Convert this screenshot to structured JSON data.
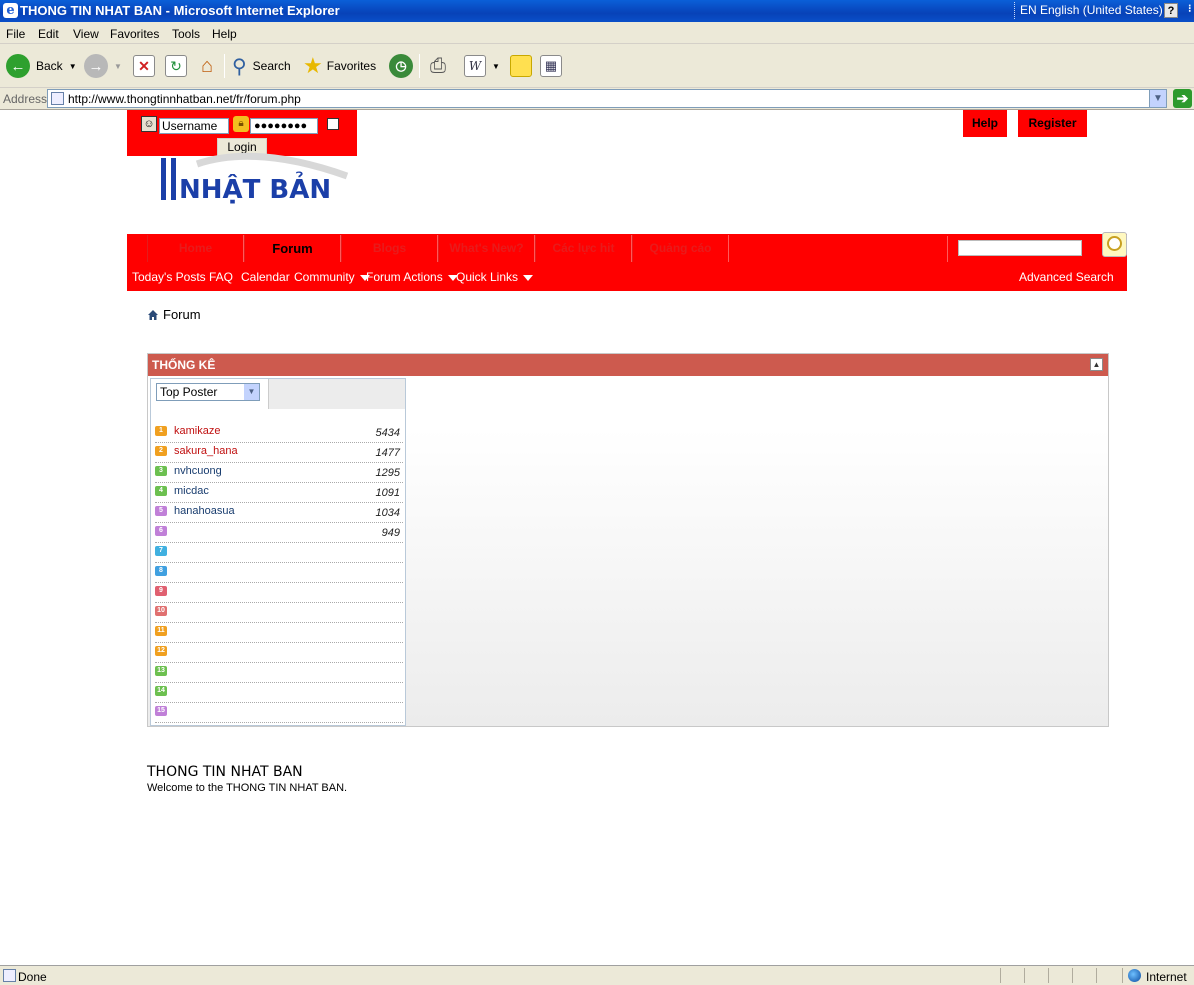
{
  "window": {
    "title": "THONG TIN NHAT BAN - Microsoft Internet Explorer",
    "language": "EN English (United States)"
  },
  "menu": [
    "File",
    "Edit",
    "View",
    "Favorites",
    "Tools",
    "Help"
  ],
  "toolbar": {
    "back": "Back",
    "search": "Search",
    "favorites": "Favorites"
  },
  "address": {
    "label": "Address",
    "url": "http://www.thongtinnhatban.net/fr/forum.php"
  },
  "login": {
    "username_placeholder": "Username",
    "password_mask": "●●●●●●●●",
    "login_label": "Login"
  },
  "header": {
    "help": "Help",
    "register": "Register"
  },
  "logo": {
    "text": "NHẬT BẢN"
  },
  "nav": {
    "tabs": [
      "Home",
      "Forum",
      "Blogs",
      "What's New?",
      "Các lực hit",
      "Quảng cáo"
    ],
    "active": "Forum"
  },
  "subnav": {
    "items": [
      "Today's Posts",
      "FAQ",
      "Calendar",
      "Community",
      "Forum Actions",
      "Quick Links"
    ],
    "advanced_search": "Advanced Search"
  },
  "breadcrumb": {
    "label": "Forum"
  },
  "stats": {
    "title": "THỐNG KÊ",
    "selector": "Top Poster",
    "rows": [
      {
        "rank": "1",
        "name": "kamikaze",
        "count": "5434",
        "color": "#f0a020"
      },
      {
        "rank": "2",
        "name": "sakura_hana",
        "count": "1477",
        "color": "#f0a020"
      },
      {
        "rank": "3",
        "name": "nvhcuong",
        "count": "1295",
        "color": "#6cc050"
      },
      {
        "rank": "4",
        "name": "micdac",
        "count": "1091",
        "color": "#6cc050"
      },
      {
        "rank": "5",
        "name": "hanahoasua",
        "count": "1034",
        "color": "#c080d8"
      },
      {
        "rank": "6",
        "name": "",
        "count": "949",
        "color": "#c080d8"
      },
      {
        "rank": "7",
        "name": "",
        "count": "",
        "color": "#40b0e0"
      },
      {
        "rank": "8",
        "name": "",
        "count": "",
        "color": "#40a0e0"
      },
      {
        "rank": "9",
        "name": "",
        "count": "",
        "color": "#e06070"
      },
      {
        "rank": "10",
        "name": "",
        "count": "",
        "color": "#e07070"
      },
      {
        "rank": "11",
        "name": "",
        "count": "",
        "color": "#f0a020"
      },
      {
        "rank": "12",
        "name": "",
        "count": "",
        "color": "#f0a020"
      },
      {
        "rank": "13",
        "name": "",
        "count": "",
        "color": "#6cc050"
      },
      {
        "rank": "14",
        "name": "",
        "count": "",
        "color": "#6cc050"
      },
      {
        "rank": "15",
        "name": "",
        "count": "",
        "color": "#c080d8"
      }
    ]
  },
  "footer": {
    "title": "THONG TIN NHAT BAN",
    "welcome": "Welcome to the THONG TIN NHAT BAN."
  },
  "status": {
    "text": "Done",
    "zone": "Internet"
  }
}
